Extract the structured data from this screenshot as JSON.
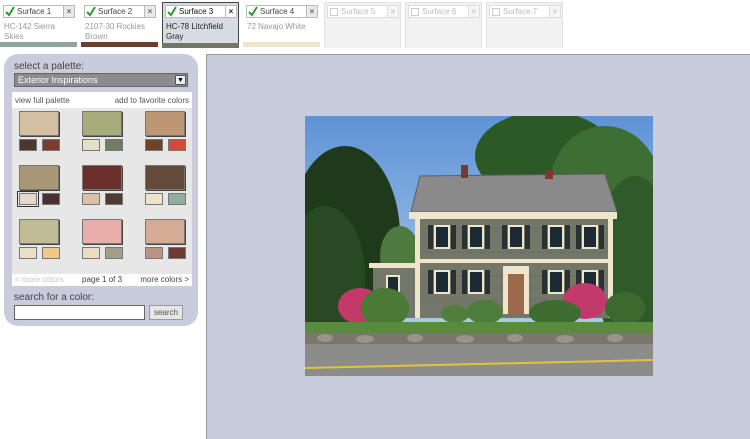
{
  "surfaces": [
    {
      "label": "Surface 1",
      "color_name": "HC-142 Sierra Skies",
      "bar_color": "#8fa59b",
      "state": "active",
      "checked": true
    },
    {
      "label": "Surface 2",
      "color_name": "2107-30 Rockies Brown",
      "bar_color": "#6b3e2e",
      "state": "active",
      "checked": true
    },
    {
      "label": "Surface 3",
      "color_name": "HC-78 Litchfield Gray",
      "bar_color": "#72776a",
      "state": "selected",
      "checked": true
    },
    {
      "label": "Surface 4",
      "color_name": "72 Navajo White",
      "bar_color": "#efe4cc",
      "state": "active",
      "checked": true
    },
    {
      "label": "Surface 5",
      "color_name": "",
      "bar_color": "",
      "state": "dim",
      "checked": false
    },
    {
      "label": "Surface 6",
      "color_name": "",
      "bar_color": "",
      "state": "dim",
      "checked": false
    },
    {
      "label": "Surface 7",
      "color_name": "",
      "bar_color": "",
      "state": "dim",
      "checked": false
    }
  ],
  "panel": {
    "title": "select a palette:",
    "selected_palette": "Exterior Inspirations",
    "view_full_palette": "view full palette",
    "add_favorites": "add to favorite colors",
    "swatches": [
      {
        "main": "#d3bfa2",
        "small": [
          "#4c3630",
          "#7a3d2e"
        ]
      },
      {
        "main": "#a6ac7a",
        "small": [
          "#e1e1c5",
          "#6f7c66"
        ]
      },
      {
        "main": "#bd9673",
        "small": [
          "#6e4427",
          "#d04c3a"
        ]
      },
      {
        "main": "#a89677",
        "small": [
          "#e4dac9",
          "#4a3033"
        ],
        "selected_small": 0
      },
      {
        "main": "#6a2f2b",
        "small": [
          "#d7c2a5",
          "#4f3a35"
        ]
      },
      {
        "main": "#654b3a",
        "small": [
          "#ece3cd",
          "#8fae9f"
        ]
      },
      {
        "main": "#c1bb96",
        "small": [
          "#ebe0c7",
          "#eec98a"
        ]
      },
      {
        "main": "#e9aeaa",
        "small": [
          "#ecdcc2",
          "#9ea087"
        ]
      },
      {
        "main": "#d6ab94",
        "small": [
          "#b89485",
          "#6a3c33"
        ]
      }
    ],
    "more_colors_prev": "< more colors",
    "page_indicator": "page 1 of 3",
    "more_colors_next": "more colors >",
    "search_label": "search for a color:",
    "search_value": "",
    "search_button": "search"
  },
  "icons": {
    "tab_check": "check-icon",
    "tab_close": "close-icon",
    "dropdown": "chevron-down-icon"
  },
  "colors": {
    "panel_bg": "#c9ccdc",
    "siding": "#72776a",
    "trim": "#efe4cc",
    "roof": "#8a8a8a"
  }
}
